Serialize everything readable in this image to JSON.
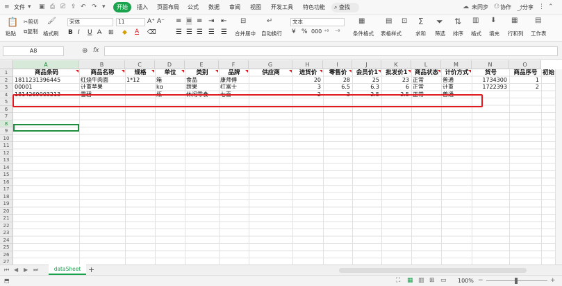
{
  "menu": {
    "file": "文件",
    "tabs": [
      "开始",
      "插入",
      "页面布局",
      "公式",
      "数据",
      "审阅",
      "视图",
      "开发工具",
      "特色功能"
    ],
    "search": "查找",
    "right": [
      "未同步",
      "协作",
      "分享"
    ]
  },
  "ribbon": {
    "paste": "粘贴",
    "cut": "剪切",
    "copy": "复制",
    "format_painter": "格式刷",
    "font_name": "宋体",
    "font_size": "11",
    "merge": "合并居中",
    "wrap": "自动换行",
    "number_format": "文本",
    "conditional": "条件格式",
    "table_style": "表格样式",
    "sum": "求和",
    "filter": "筛选",
    "sort": "排序",
    "format": "格式",
    "fill": "填充",
    "row_col": "行和列",
    "worksheet": "工作表"
  },
  "formula_bar": {
    "cell_ref": "A8",
    "fx": "fx"
  },
  "columns": [
    "A",
    "B",
    "C",
    "D",
    "E",
    "F",
    "G",
    "H",
    "I",
    "J",
    "K",
    "L",
    "M",
    "N",
    "O"
  ],
  "rows": [
    "1",
    "2",
    "3",
    "4",
    "5",
    "6",
    "7",
    "8",
    "9",
    "10",
    "11",
    "12",
    "13",
    "14",
    "15",
    "16",
    "17",
    "18",
    "19",
    "20",
    "21",
    "22",
    "23",
    "24",
    "25",
    "26",
    "27"
  ],
  "table": {
    "headers": [
      "商品条码",
      "商品名称",
      "规格",
      "单位",
      "类别",
      "品牌",
      "供应商",
      "进货价",
      "零售价",
      "会员价1",
      "批发价1",
      "商品状态",
      "计价方式",
      "货号",
      "商品序号",
      "初始"
    ],
    "row2": [
      "1811231396445",
      "红烧牛肉面",
      "1*12",
      "箱",
      "食品",
      "康师傅",
      "",
      "20",
      "28",
      "25",
      "23",
      "正常",
      "普通",
      "1734300",
      "1",
      ""
    ],
    "row3": [
      "00001",
      "计重苹果",
      "",
      "kg",
      "蔬果",
      "红富士",
      "",
      "3",
      "6.5",
      "6.3",
      "6",
      "正常",
      "计重",
      "1722393",
      "2",
      ""
    ],
    "row4": [
      "1814269003213",
      "雪碧",
      "",
      "瓶",
      "休闲零食",
      "七喜",
      "",
      "2",
      "3",
      "2.5",
      "2.5",
      "正常",
      "普通",
      "",
      "",
      ""
    ]
  },
  "sheet": {
    "tab": "dataSheet",
    "add": "+"
  },
  "status": {
    "zoom": "100%"
  },
  "colors": {
    "accent": "#1aa24d",
    "highlight": "#e0191e"
  }
}
